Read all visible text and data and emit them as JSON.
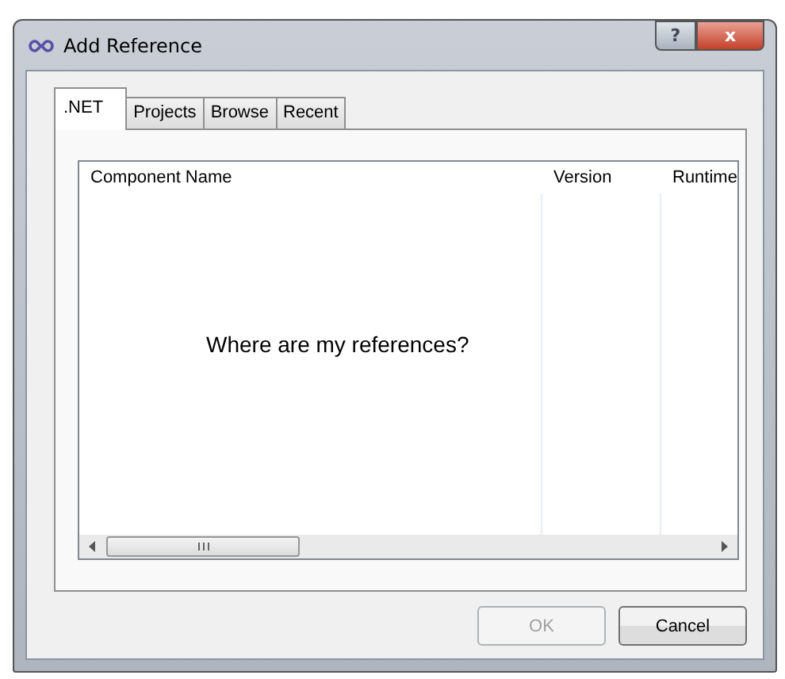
{
  "window": {
    "title": "Add Reference",
    "help": "?",
    "close": "x"
  },
  "tabs": [
    {
      "label": ".NET",
      "selected": true
    },
    {
      "label": "Projects",
      "selected": false
    },
    {
      "label": "Browse",
      "selected": false
    },
    {
      "label": "Recent",
      "selected": false
    }
  ],
  "table": {
    "columns": [
      "Component Name",
      "Version",
      "Runtime"
    ],
    "empty_message": "Where are my references?"
  },
  "buttons": [
    {
      "label": "OK",
      "disabled": true
    },
    {
      "label": "Cancel",
      "disabled": false
    }
  ]
}
